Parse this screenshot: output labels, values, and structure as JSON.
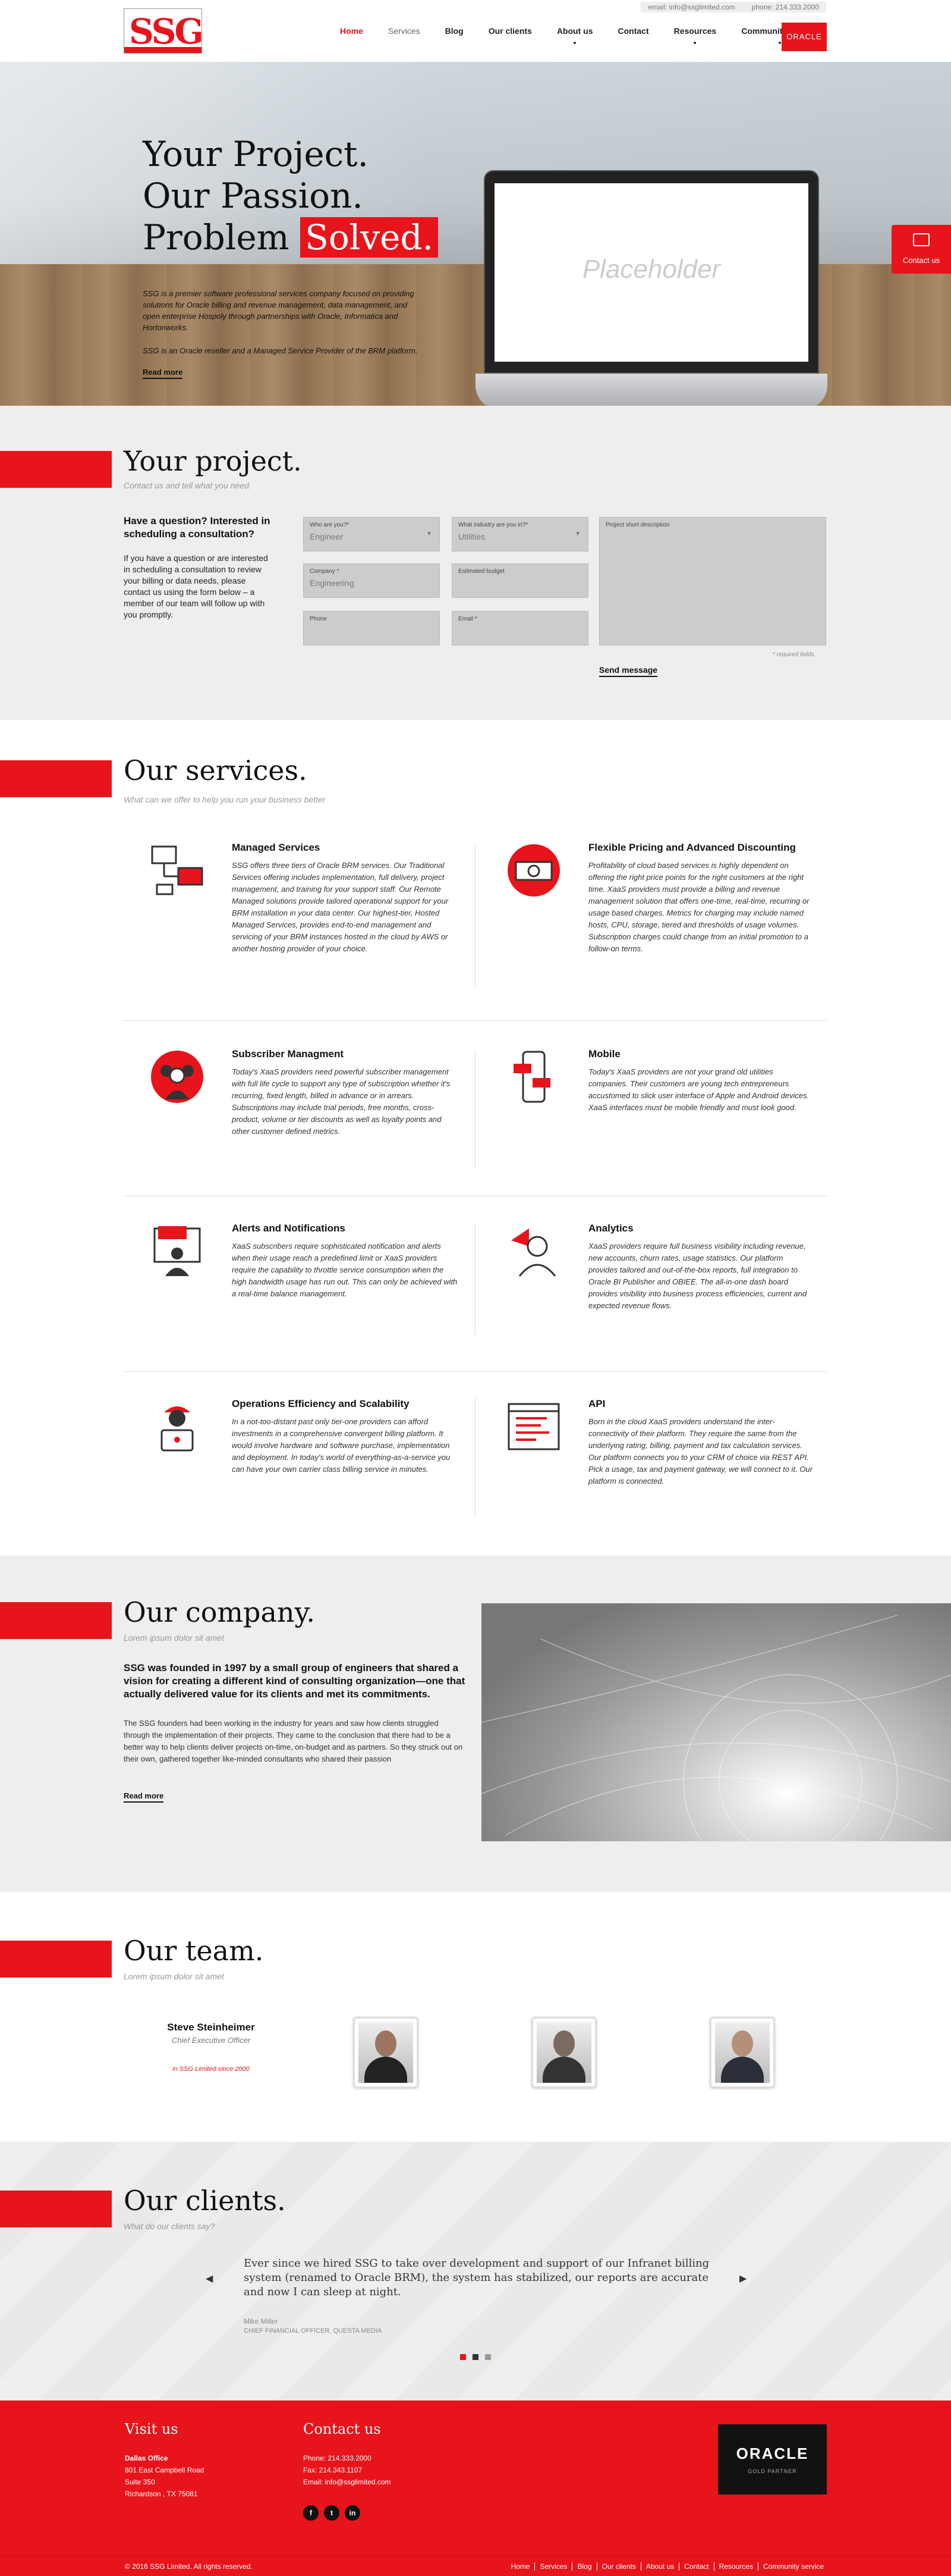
{
  "topbar": {
    "email": "email:  info@ssglimited.com",
    "phone": "phone:  214.333.2000"
  },
  "logo": {
    "text": "SSG"
  },
  "nav": {
    "items": [
      "Home",
      "Services",
      "Blog",
      "Our clients",
      "About us",
      "Contact",
      "Resources",
      "Community service"
    ],
    "oracle_label": "ORACLE"
  },
  "hero": {
    "line1": "Your Project.",
    "line2": "Our Passion.",
    "line3a": "Problem",
    "line3b": "Solved.",
    "desc": "SSG is a premier software professional services company focused on providing solutions for Oracle billing and revenue management, data management, and open enterprise Hospoly through partnerships with Oracle, Informatica and Hortonworks.",
    "desc2": "SSG is an Oracle reseller and a Managed Service Provider of the BRM platform.",
    "read_more": "Read more",
    "placeholder": "Placeholder",
    "contact_us": "Contact us"
  },
  "project": {
    "title": "Your project.",
    "subtitle": "Contact us and tell what you need.",
    "question": "Have a question? Interested in scheduling a consultation?",
    "paragraph": "If you have a question or are interested in scheduling a consultation to review your billing or data needs, please contact us using the form below – a member of our team will follow up with you promptly.",
    "fields": {
      "who_label": "Who are you?*",
      "who_value": "Engineer",
      "industry_label": "What industry are you in?*",
      "industry_value": "Utilities",
      "company_label": "Company *",
      "company_value": "Engineering",
      "budget_label": "Estimated budget",
      "phone_label": "Phone",
      "email_label": "Email *",
      "desc_label": "Project short description"
    },
    "required": "* required fields",
    "send": "Send message"
  },
  "services": {
    "title": "Our services.",
    "subtitle": "What can we offer to help you run your business better",
    "items": [
      {
        "title": "Managed Services",
        "text": "SSG offers three tiers of Oracle BRM services. Our Traditional Services offering includes implementation, full delivery, project management, and training for your support staff. Our Remote Managed solutions provide tailored operational support for your BRM installation in your data center. Our highest-tier, Hosted Managed Services, provides end-to-end management and servicing of your BRM instances hosted in the cloud by AWS or another hosting provider of your choice.",
        "icon": "computers-icon"
      },
      {
        "title": "Flexible Pricing and Advanced Discounting",
        "text": "Profitability of cloud based services is highly dependent on offering the right price points for the right customers at the right time. XaaS providers must provide a billing and revenue management solution that offers one-time, real-time, recurring or usage based charges. Metrics for charging may include named hosts, CPU, storage, tiered and thresholds of usage volumes. Subscription charges could change from an initial promotion to a follow-on terms.",
        "icon": "pricing-icon"
      },
      {
        "title": "Subscriber Managment",
        "text": "Today's XaaS providers need powerful subscriber management with full life cycle to support any type of subscription whether it's recurring, fixed length, billed in advance or in arrears. Subscriptions may include trial periods, free months, cross-product, volume or tier discounts as well as loyalty points and other customer defined metrics.",
        "icon": "subscribers-icon"
      },
      {
        "title": "Mobile",
        "text": "Today's XaaS providers are not your grand old utilities companies. Their customers are young tech entrepreneurs accustomed to slick user interface of Apple and Android devices. XaaS interfaces must be mobile friendly and must look good.",
        "icon": "mobile-icon"
      },
      {
        "title": "Alerts and Notifications",
        "text": "XaaS subscribers require sophisticated notification and alerts when their usage reach a predefined limit or XaaS providers require the capability to throttle service consumption when the high bandwidth usage has run out. This can only be achieved with a real-time balance management.",
        "icon": "alerts-icon"
      },
      {
        "title": "Analytics",
        "text": "XaaS providers require full business visibility including revenue, new accounts, churn rates, usage statistics. Our platform provides tailored and out-of-the-box reports, full integration to Oracle BI Publisher and OBIEE. The all-in-one dash board provides visibility into business process efficiencies, current and expected revenue flows.",
        "icon": "analytics-icon"
      },
      {
        "title": "Operations Efficiency and Scalability",
        "text": "In a not-too-distant past only tier-one providers can afford investments in a comprehensive convergent billing platform. It would involve hardware and software purchase, implementation and deployment. In today's world of everything-as-a-service you can have your own carrier class billing service in minutes.",
        "icon": "operations-icon"
      },
      {
        "title": "API",
        "text": "Born in the cloud XaaS providers understand the inter-connectivity of their platform. They require the same from the underlying rating, billing, payment and tax calculation services. Our platform connects you to your CRM of choice via REST API. Pick a usage, tax and payment gateway, we will connect to it. Our platform is connected.",
        "icon": "api-icon"
      }
    ]
  },
  "company": {
    "title": "Our company.",
    "subtitle": "Lorem ipsum dolor sit amet",
    "lead": "SSG was founded in 1997 by a small group of engineers that shared a vision for creating a different kind of consulting organization—one that actually delivered value for its clients and met its commitments.",
    "paragraph": "The SSG founders had been working in the industry for years and saw how clients struggled through the implementation of their projects. They came to the conclusion that there had to be a better way to help clients deliver projects on-time, on-budget and as partners. So they struck out on their own, gathered together like-minded consultants who shared their passion",
    "read_more": "Read more"
  },
  "team": {
    "title": "Our team.",
    "subtitle": "Lorem ipsum dolor sit amet",
    "name": "Steve Steinheimer",
    "role": "Chief Executive Officer",
    "since": "in SSG Limited since 2000"
  },
  "clients": {
    "title": "Our clients.",
    "subtitle": "What do our clients say?",
    "quote": "Ever since we hired SSG to take over development and support of our Infranet billing system (renamed to Oracle BRM), the system has stabilized, our reports are accurate and now I can sleep at night.",
    "name": "Mike Miller",
    "role": "CHIEF FINANCIAL OFFICER, QUESTA MEDIA"
  },
  "footer": {
    "visit_title": "Visit us",
    "office": "Dallas Office",
    "addr1": "801 East Campbell Road",
    "addr2": "Suite 350",
    "addr3": "Richardson , TX 75081",
    "contact_title": "Contact us",
    "phone": "Phone: 214.333.2000",
    "fax": "Fax: 214.343.1107",
    "email": "Email: info@ssglimited.com",
    "oracle": "ORACLE",
    "oracle_sub": "GOLD PARTNER",
    "copyright": "© 2016 SSG Limited. All rights reserved.",
    "nav": [
      "Home",
      "Services",
      "Blog",
      "Our clients",
      "About us",
      "Contact",
      "Resources",
      "Community service"
    ]
  },
  "colors": {
    "accent": "#e8141b",
    "dark": "#111111",
    "light_bg": "#eeeeee"
  }
}
